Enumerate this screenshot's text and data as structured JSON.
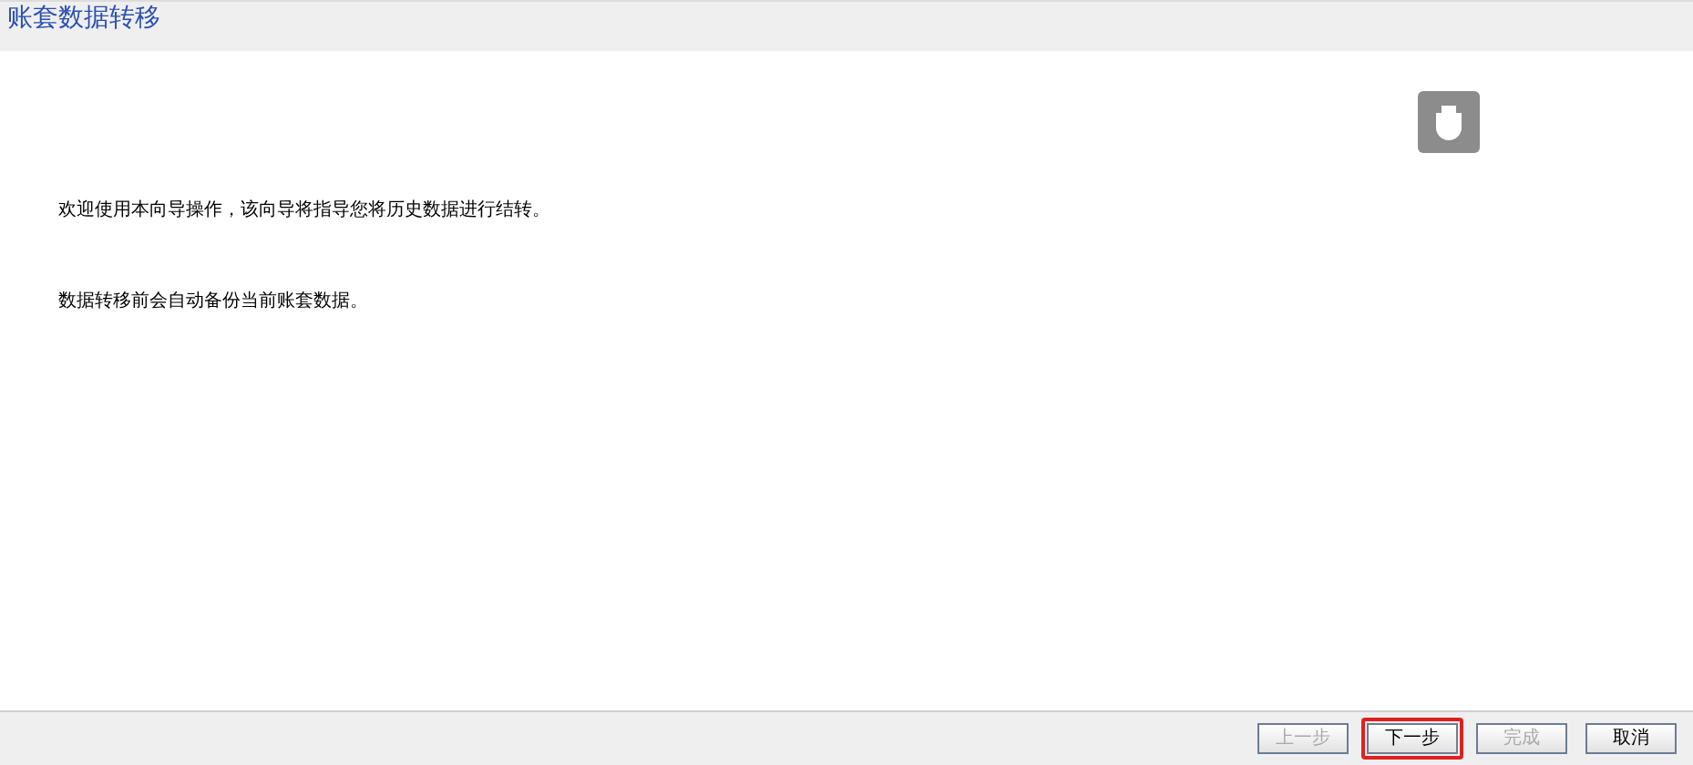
{
  "title": "账套数据转移",
  "messages": [
    "欢迎使用本向导操作，该向导将指导您将历史数据进行结转。",
    "数据转移前会自动备份当前账套数据。"
  ],
  "buttons": [
    {
      "label": "上一步",
      "disabled": true,
      "focused": false
    },
    {
      "label": "下一步",
      "disabled": false,
      "focused": true
    },
    {
      "label": "完成",
      "disabled": true,
      "focused": false
    },
    {
      "label": "取消",
      "disabled": false,
      "focused": false
    }
  ]
}
